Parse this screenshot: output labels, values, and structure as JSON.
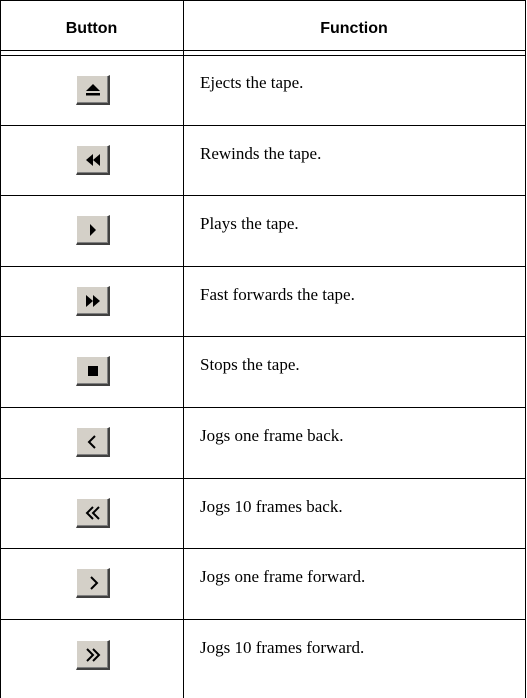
{
  "table": {
    "header": {
      "button": "Button",
      "function": "Function"
    },
    "rows": [
      {
        "icon": "eject-icon",
        "function": "Ejects the tape."
      },
      {
        "icon": "rewind-icon",
        "function": "Rewinds the tape."
      },
      {
        "icon": "play-icon",
        "function": "Plays the tape."
      },
      {
        "icon": "fast-forward-icon",
        "function": "Fast forwards the tape."
      },
      {
        "icon": "stop-icon",
        "function": "Stops the tape."
      },
      {
        "icon": "jog-back-one-icon",
        "function": "Jogs one frame back."
      },
      {
        "icon": "jog-back-ten-icon",
        "function": "Jogs 10 frames back."
      },
      {
        "icon": "jog-forward-one-icon",
        "function": "Jogs one frame forward."
      },
      {
        "icon": "jog-forward-ten-icon",
        "function": "Jogs 10 frames forward."
      }
    ]
  },
  "colors": {
    "button_face": "#d4d0c8",
    "button_shadow": "#404040",
    "rule": "#000000"
  }
}
